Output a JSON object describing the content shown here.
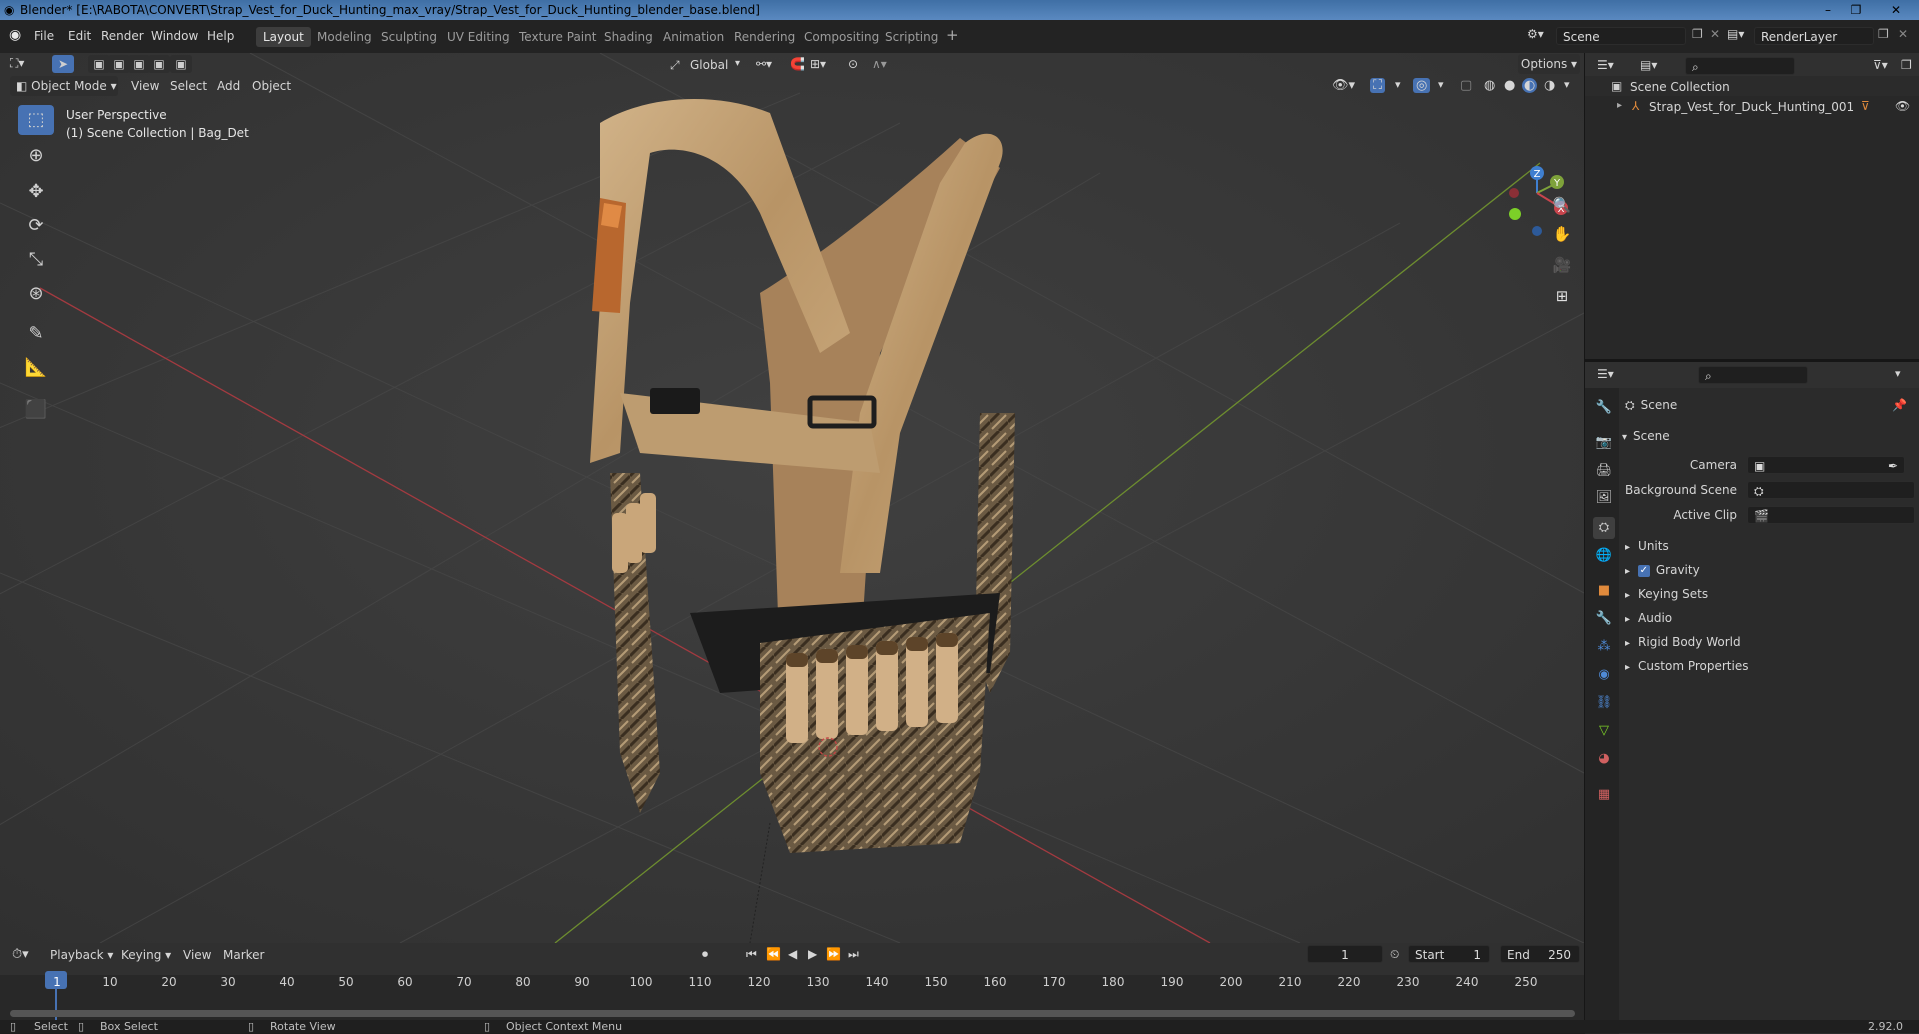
{
  "window": {
    "title": "Blender* [E:\\RABOTA\\CONVERT\\Strap_Vest_for_Duck_Hunting_max_vray/Strap_Vest_for_Duck_Hunting_blender_base.blend]"
  },
  "menu": [
    "File",
    "Edit",
    "Render",
    "Window",
    "Help"
  ],
  "workspaces": [
    "Layout",
    "Modeling",
    "Sculpting",
    "UV Editing",
    "Texture Paint",
    "Shading",
    "Animation",
    "Rendering",
    "Compositing",
    "Scripting"
  ],
  "scene_field": "Scene",
  "renderlayer_field": "RenderLayer",
  "viewport": {
    "transform": "Global",
    "options": "Options",
    "mode": "Object Mode",
    "menus": [
      "View",
      "Select",
      "Add",
      "Object"
    ],
    "perspective": "User Perspective",
    "collection_info": "(1) Scene Collection | Bag_Det",
    "axis_labels": {
      "z": "Z",
      "y": "Y",
      "x": "X"
    }
  },
  "outliner": {
    "root": "Scene Collection",
    "items": [
      {
        "label": "Strap_Vest_for_Duck_Hunting_001"
      }
    ]
  },
  "properties": {
    "context": "Scene",
    "panel": "Scene",
    "fields": [
      {
        "label": "Camera"
      },
      {
        "label": "Background Scene"
      },
      {
        "label": "Active Clip"
      }
    ],
    "sections": [
      "Units",
      "Gravity",
      "Keying Sets",
      "Audio",
      "Rigid Body World",
      "Custom Properties"
    ],
    "gravity_checked": true
  },
  "timeline": {
    "menus": [
      "Playback",
      "Keying",
      "View",
      "Marker"
    ],
    "current_frame": "1",
    "start_label": "Start",
    "start": "1",
    "end_label": "End",
    "end": "250",
    "ticks": [
      "1",
      "10",
      "20",
      "30",
      "40",
      "50",
      "60",
      "70",
      "80",
      "90",
      "100",
      "110",
      "120",
      "130",
      "140",
      "150",
      "160",
      "170",
      "180",
      "190",
      "200",
      "210",
      "220",
      "230",
      "240",
      "250"
    ]
  },
  "status": {
    "items": [
      "Select",
      "Box Select",
      "Rotate View",
      "Object Context Menu"
    ],
    "version": "2.92.0"
  },
  "colors": {
    "accent": "#4772b3",
    "x_axis": "#c8454d",
    "y_axis": "#7ea23a",
    "z_axis": "#3f7fd0"
  }
}
